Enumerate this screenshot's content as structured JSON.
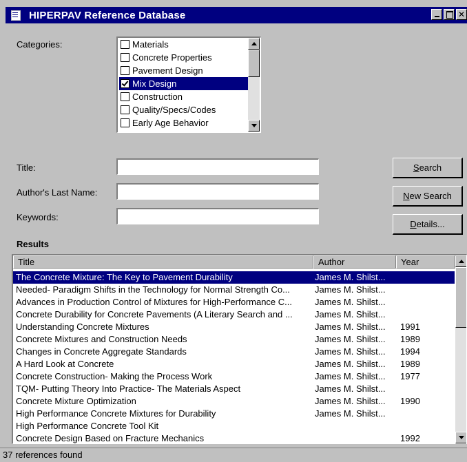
{
  "window": {
    "title": "HIPERPAV Reference Database",
    "buttons": {
      "close": "✕"
    }
  },
  "categories": {
    "label": "Categories:",
    "items": [
      {
        "label": "Materials",
        "checked": false
      },
      {
        "label": "Concrete Properties",
        "checked": false
      },
      {
        "label": "Pavement Design",
        "checked": false
      },
      {
        "label": "Mix Design",
        "checked": true
      },
      {
        "label": "Construction",
        "checked": false
      },
      {
        "label": "Quality/Specs/Codes",
        "checked": false
      },
      {
        "label": "Early Age Behavior",
        "checked": false
      }
    ]
  },
  "fields": {
    "title": {
      "label": "Title:",
      "value": ""
    },
    "author": {
      "label": "Author's Last Name:",
      "value": ""
    },
    "keywords": {
      "label": "Keywords:",
      "value": ""
    }
  },
  "buttons": {
    "search": {
      "mnemonic": "S",
      "rest": "earch"
    },
    "new_search": {
      "mnemonic": "N",
      "rest": "ew Search"
    },
    "details": {
      "mnemonic": "D",
      "rest": "etails..."
    }
  },
  "results": {
    "heading": "Results",
    "columns": [
      "Title",
      "Author",
      "Year"
    ],
    "rows": [
      {
        "title": "The Concrete Mixture:  The Key to Pavement Durability",
        "author": "James M. Shilst...",
        "year": ""
      },
      {
        "title": "Needed- Paradigm Shifts in the Technology for Normal Strength Co...",
        "author": "James M. Shilst...",
        "year": ""
      },
      {
        "title": "Advances in Production Control of Mixtures for High-Performance C...",
        "author": "James M. Shilst...",
        "year": ""
      },
      {
        "title": "Concrete Durability for Concrete Pavements (A Literary Search and ...",
        "author": "James M. Shilst...",
        "year": ""
      },
      {
        "title": "Understanding Concrete Mixtures",
        "author": "James M. Shilst...",
        "year": "1991"
      },
      {
        "title": "Concrete Mixtures and Construction Needs",
        "author": "James M. Shilst...",
        "year": "1989"
      },
      {
        "title": "Changes in Concrete Aggregate Standards",
        "author": "James M. Shilst...",
        "year": "1994"
      },
      {
        "title": "A Hard Look at Concrete",
        "author": "James M. Shilst...",
        "year": "1989"
      },
      {
        "title": "Concrete Construction- Making the Process Work",
        "author": "James M. Shilst...",
        "year": "1977"
      },
      {
        "title": "TQM- Putting Theory Into Practice- The Materials Aspect",
        "author": "James M. Shilst...",
        "year": ""
      },
      {
        "title": "Concrete Mixture Optimization",
        "author": "James M. Shilst...",
        "year": "1990"
      },
      {
        "title": "High Performance Concrete Mixtures for Durability",
        "author": "James M. Shilst...",
        "year": ""
      },
      {
        "title": "High Performance Concrete Tool Kit",
        "author": "",
        "year": ""
      },
      {
        "title": "Concrete Design Based on Fracture Mechanics",
        "author": "",
        "year": "1992"
      }
    ]
  },
  "status": {
    "text": "37 references found"
  }
}
